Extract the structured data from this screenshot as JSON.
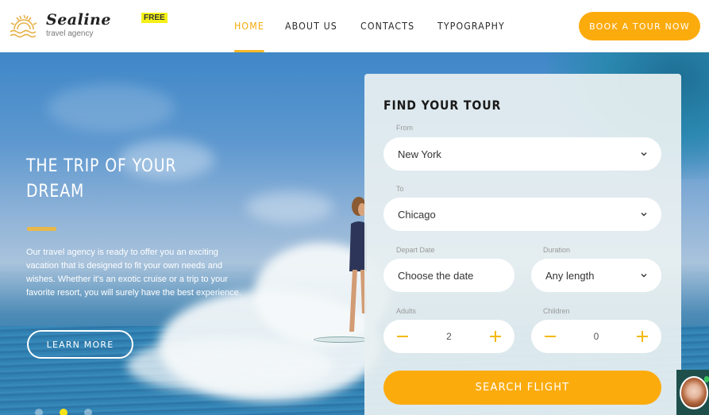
{
  "brand": {
    "name": "Sealine",
    "tagline": "travel agency",
    "badge": "FREE",
    "icon": "sun-over-waves-icon"
  },
  "nav": {
    "items": [
      {
        "label": "HOME",
        "active": true
      },
      {
        "label": "ABOUT US",
        "active": false
      },
      {
        "label": "CONTACTS",
        "active": false
      },
      {
        "label": "TYPOGRAPHY",
        "active": false
      }
    ],
    "cta_label": "BOOK A TOUR NOW"
  },
  "hero": {
    "title": "THE TRIP OF YOUR DREAM",
    "text": "Our travel agency is ready to offer you an exciting vacation that is designed to fit your own needs and wishes. Whether it's an exotic cruise or a trip to your favorite resort, you will surely have the best experience.",
    "button_label": "LEARN MORE",
    "slides": {
      "count": 3,
      "active_index": 1
    }
  },
  "search_form": {
    "title": "FIND YOUR TOUR",
    "from": {
      "label": "From",
      "value": "New York"
    },
    "to": {
      "label": "To",
      "value": "Chicago"
    },
    "depart_date": {
      "label": "Depart Date",
      "placeholder": "Choose the date"
    },
    "duration": {
      "label": "Duration",
      "value": "Any length"
    },
    "adults": {
      "label": "Adults",
      "value": "2"
    },
    "children": {
      "label": "Children",
      "value": "0"
    },
    "submit_label": "SEARCH FLIGHT"
  },
  "colors": {
    "accent": "#fcab0d",
    "nav_active": "#f5a90a",
    "badge": "#f4f018",
    "slider_dot_active": "#f4e21a"
  },
  "chat_widget": {
    "icon": "support-avatar-icon",
    "status": "online"
  }
}
